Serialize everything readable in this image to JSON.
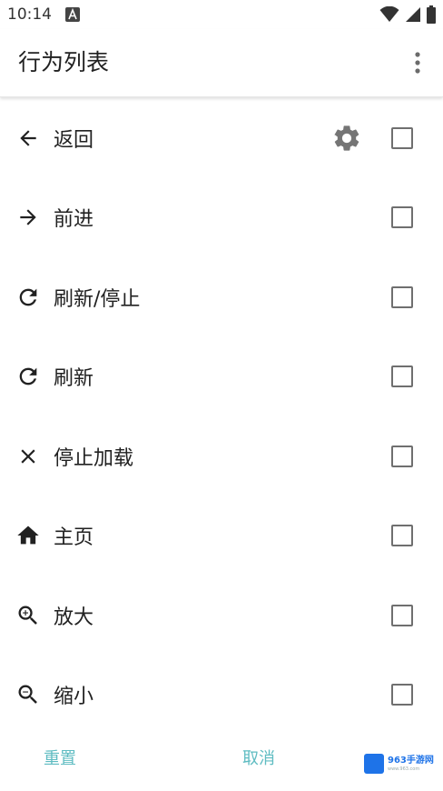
{
  "status_bar": {
    "time": "10:14",
    "indicator_icon": "a-badge-icon",
    "icons": [
      "wifi-icon",
      "signal-icon",
      "battery-icon"
    ]
  },
  "app_bar": {
    "title": "行为列表",
    "menu_icon": "more-vert-icon"
  },
  "actions": [
    {
      "label": "返回",
      "icon": "arrow-back-icon",
      "has_settings": true,
      "checked": false
    },
    {
      "label": "前进",
      "icon": "arrow-forward-icon",
      "has_settings": false,
      "checked": false
    },
    {
      "label": "刷新/停止",
      "icon": "refresh-icon",
      "has_settings": false,
      "checked": false
    },
    {
      "label": "刷新",
      "icon": "refresh-icon",
      "has_settings": false,
      "checked": false
    },
    {
      "label": "停止加载",
      "icon": "close-icon",
      "has_settings": false,
      "checked": false
    },
    {
      "label": "主页",
      "icon": "home-icon",
      "has_settings": false,
      "checked": false
    },
    {
      "label": "放大",
      "icon": "zoom-in-icon",
      "has_settings": false,
      "checked": false
    },
    {
      "label": "缩小",
      "icon": "zoom-out-icon",
      "has_settings": false,
      "checked": false
    }
  ],
  "footer": {
    "reset_label": "重置",
    "cancel_label": "取消"
  },
  "watermark": {
    "main": "963手游网",
    "sub": "www.963.com"
  },
  "colors": {
    "accent": "#5fbcc2",
    "text": "#212121",
    "checkbox_border": "#6f6f6f",
    "gear": "#757575"
  }
}
